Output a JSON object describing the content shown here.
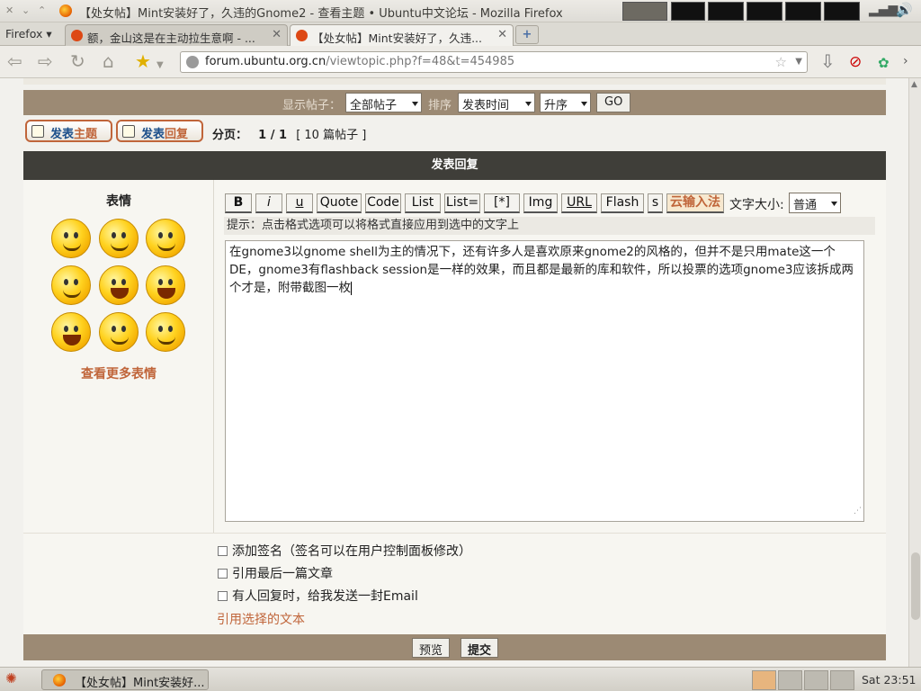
{
  "window": {
    "title": "【处女帖】Mint安装好了，久违的Gnome2 - 查看主题 • Ubuntu中文论坛 - Mozilla Firefox"
  },
  "tabs": {
    "firefox_menu": "Firefox ▾",
    "items": [
      {
        "label": "额，金山这是在主动拉生意啊 - ...",
        "close": "✕"
      },
      {
        "label": "【处女帖】Mint安装好了，久违...",
        "close": "✕"
      }
    ],
    "new_tab": "+"
  },
  "nav": {
    "url_host": "forum.ubuntu.org.cn",
    "url_path": "/viewtopic.php?f=48&t=454985"
  },
  "sort": {
    "show_posts_label": "显示帖子：",
    "show_posts_value": "全部帖子",
    "sort_label": "排序",
    "sort_value": "发表时间",
    "order_value": "升序",
    "go": "GO"
  },
  "actions": {
    "new_topic_pre": "发表",
    "new_topic_post": "主题",
    "reply_pre": "发表",
    "reply_post": "回复"
  },
  "pagination": {
    "label": "分页：",
    "pages": "1 / 1",
    "count": "[ 10 篇帖子 ]"
  },
  "post_reply": {
    "header": "发表回复",
    "emoticons_title": "表情",
    "more_emoticons": "查看更多表情",
    "toolbar": [
      "B",
      "i",
      "u",
      "Quote",
      "Code",
      "List",
      "List=",
      "[*]",
      "Img",
      "URL",
      "Flash",
      "s"
    ],
    "cloud_input": "云输入法",
    "font_size_label": "文字大小:",
    "font_size_value": "普通",
    "hint": "提示：点击格式选项可以将格式直接应用到选中的文字上",
    "message": "在gnome3以gnome shell为主的情况下，还有许多人是喜欢原来gnome2的风格的，但并不是只用mate这一个DE，gnome3有flashback session是一样的效果，而且都是最新的库和软件，所以投票的选项gnome3应该拆成两个才是，附带截图一枚",
    "options": [
      "添加签名（签名可以在用户控制面板修改）",
      "引用最后一篇文章",
      "有人回复时，给我发送一封Email"
    ],
    "quote_selected": "引用选择的文本",
    "preview": "预览",
    "submit": "提交"
  },
  "taskbar": {
    "window_label": "【处女帖】Mint安装好...",
    "clock": "Sat 23:51"
  },
  "colors": {
    "accent": "#c0653a",
    "header_dark": "#3f3e39",
    "bar_brown": "#9c8a74"
  }
}
